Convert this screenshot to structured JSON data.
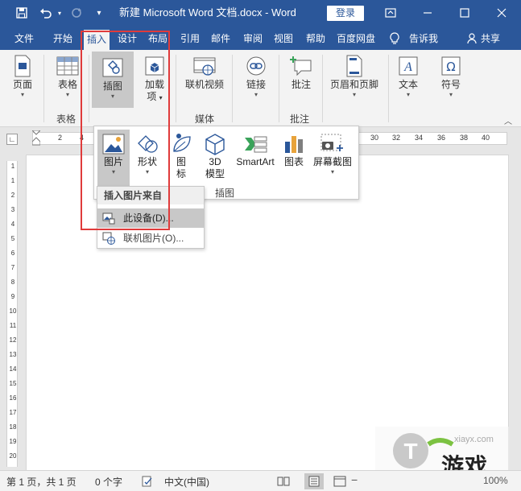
{
  "app": {
    "title": "新建 Microsoft Word 文档.docx  -  Word",
    "login_label": "登录"
  },
  "tabs": [
    {
      "label": "文件"
    },
    {
      "label": "开始"
    },
    {
      "label": "插入",
      "active": true
    },
    {
      "label": "设计"
    },
    {
      "label": "布局"
    },
    {
      "label": "引用"
    },
    {
      "label": "邮件"
    },
    {
      "label": "审阅"
    },
    {
      "label": "视图"
    },
    {
      "label": "帮助"
    },
    {
      "label": "百度网盘"
    },
    {
      "label": "告诉我"
    },
    {
      "label": "共享"
    }
  ],
  "ribbon": {
    "page_label": "页面",
    "table_label": "表格",
    "table_group": "表格",
    "illustrations_label": "插图",
    "addins_label_1": "加载",
    "addins_label_2": "项",
    "online_video_label": "联机视频",
    "media_group": "媒体",
    "link_label": "链接",
    "comment_label": "批注",
    "comment_group": "批注",
    "header_footer_label": "页眉和页脚",
    "text_label": "文本",
    "symbol_label": "符号"
  },
  "gallery": {
    "picture_label": "图片",
    "shapes_label": "形状",
    "icons_label_1": "图",
    "icons_label_2": "标",
    "model3d_label_1": "3D",
    "model3d_label_2": "模型",
    "smartart_label": "SmartArt",
    "chart_label": "图表",
    "screenshot_label": "屏幕截图",
    "group_label": "插图"
  },
  "picture_menu": {
    "header": "插入图片来自",
    "items": [
      {
        "label": "此设备(D)..."
      },
      {
        "label": "联机图片(O)..."
      }
    ]
  },
  "ruler": {
    "h_numbers": [
      "2",
      "4",
      "30",
      "32",
      "34",
      "36",
      "38",
      "40"
    ],
    "v_numbers": [
      "1",
      "1",
      "2",
      "3",
      "4",
      "5",
      "6",
      "7",
      "8",
      "9",
      "10",
      "11",
      "12",
      "13",
      "14",
      "15",
      "16",
      "17",
      "18",
      "19",
      "20"
    ]
  },
  "statusbar": {
    "page": "第 1 页，共 1 页",
    "words": "0 个字",
    "language": "中文(中国)",
    "zoom": "100%"
  },
  "watermark": {
    "text": "游戏",
    "sub": "xiayx.com"
  },
  "colors": {
    "accent": "#2b579a",
    "highlight": "#e03b3b"
  }
}
